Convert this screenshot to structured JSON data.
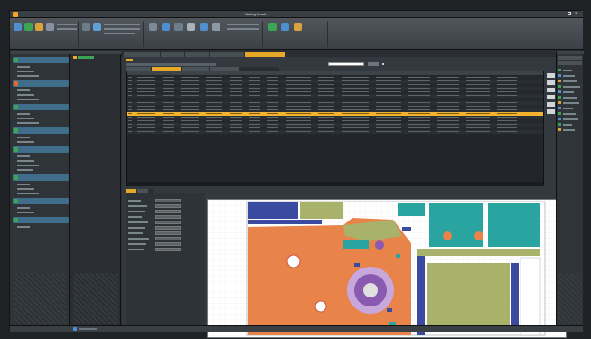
{
  "window": {
    "title": "Nesting Result 1"
  },
  "ribbon": {
    "groups": [
      {
        "label": "",
        "items": [
          "",
          "",
          "",
          ""
        ]
      },
      {
        "label": "",
        "items": [
          "",
          "",
          ""
        ]
      },
      {
        "label": "",
        "items": [
          "",
          "",
          "",
          ""
        ]
      },
      {
        "label": "",
        "items": [
          "",
          "",
          ""
        ]
      }
    ]
  },
  "left_panel": {
    "sections": [
      {
        "label": "",
        "color": "#3aa655",
        "items": [
          "",
          "",
          ""
        ]
      },
      {
        "label": "",
        "color": "#e06a2a",
        "items": [
          "",
          "",
          ""
        ]
      },
      {
        "label": "",
        "color": "#3aa655",
        "items": [
          "",
          "",
          ""
        ]
      },
      {
        "label": "",
        "color": "#3aa655",
        "items": [
          "",
          ""
        ]
      },
      {
        "label": "",
        "color": "#3aa655",
        "items": [
          "",
          "",
          "",
          ""
        ]
      },
      {
        "label": "",
        "color": "#3aa655",
        "items": [
          "",
          "",
          ""
        ]
      },
      {
        "label": "",
        "color": "#3aa655",
        "items": [
          "",
          ""
        ]
      },
      {
        "label": "",
        "color": "#3aa655",
        "items": [
          ""
        ]
      }
    ]
  },
  "grid": {
    "selected_row_index": 10,
    "row_count": 16,
    "columns": [
      "",
      "",
      "",
      "",
      "",
      "",
      "",
      "",
      "",
      "",
      "",
      "",
      "",
      "",
      "",
      ""
    ]
  },
  "colors": {
    "accent": "#f5a623",
    "highlight_row": "#f2b42e",
    "sheet_orange": "#e8834a",
    "sheet_teal": "#2aa4a0",
    "sheet_purple": "#8a5ab0",
    "sheet_green": "#a8b26a",
    "sheet_navy": "#2f3d8a"
  }
}
